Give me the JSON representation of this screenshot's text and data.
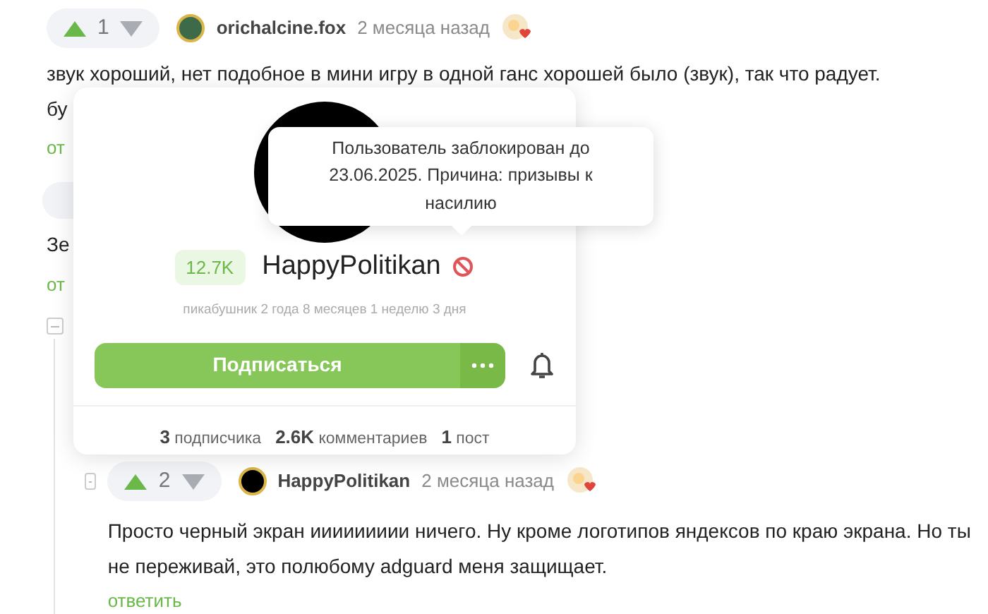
{
  "comment": {
    "rating": "1",
    "author": "orichalcine.fox",
    "time": "2 месяца назад",
    "text": "звук хороший, нет подобное в мини игру в одной ганс хорошей было (звук), так что радует.",
    "second_line": "бу",
    "reply": "от"
  },
  "hidden_comment": {
    "text": "Зе",
    "reply": "от"
  },
  "reply_comment": {
    "rating": "2",
    "author": "HappyPolitikan",
    "time": "2 месяца назад",
    "text": "Просто черный экран иииииииии ничего. Ну кроме логотипов яндексов по краю экрана. Но ты не переживай, это полюбому adguard меня защищает.",
    "reply": "ответить"
  },
  "profile_popup": {
    "rating": "12.7K",
    "name": "HappyPolitikan",
    "banned": true,
    "tenure": "пикабушник 2 года 8 месяцев 1 неделю 3 дня",
    "subscribe": "Подписаться",
    "stats": [
      "**3** подписчика",
      "**2.6K** комментариев",
      "**1** пост"
    ]
  },
  "tooltip": {
    "text": "Пользователь заблокирован до 23.06.2025. Причина: призывы к насилию"
  }
}
